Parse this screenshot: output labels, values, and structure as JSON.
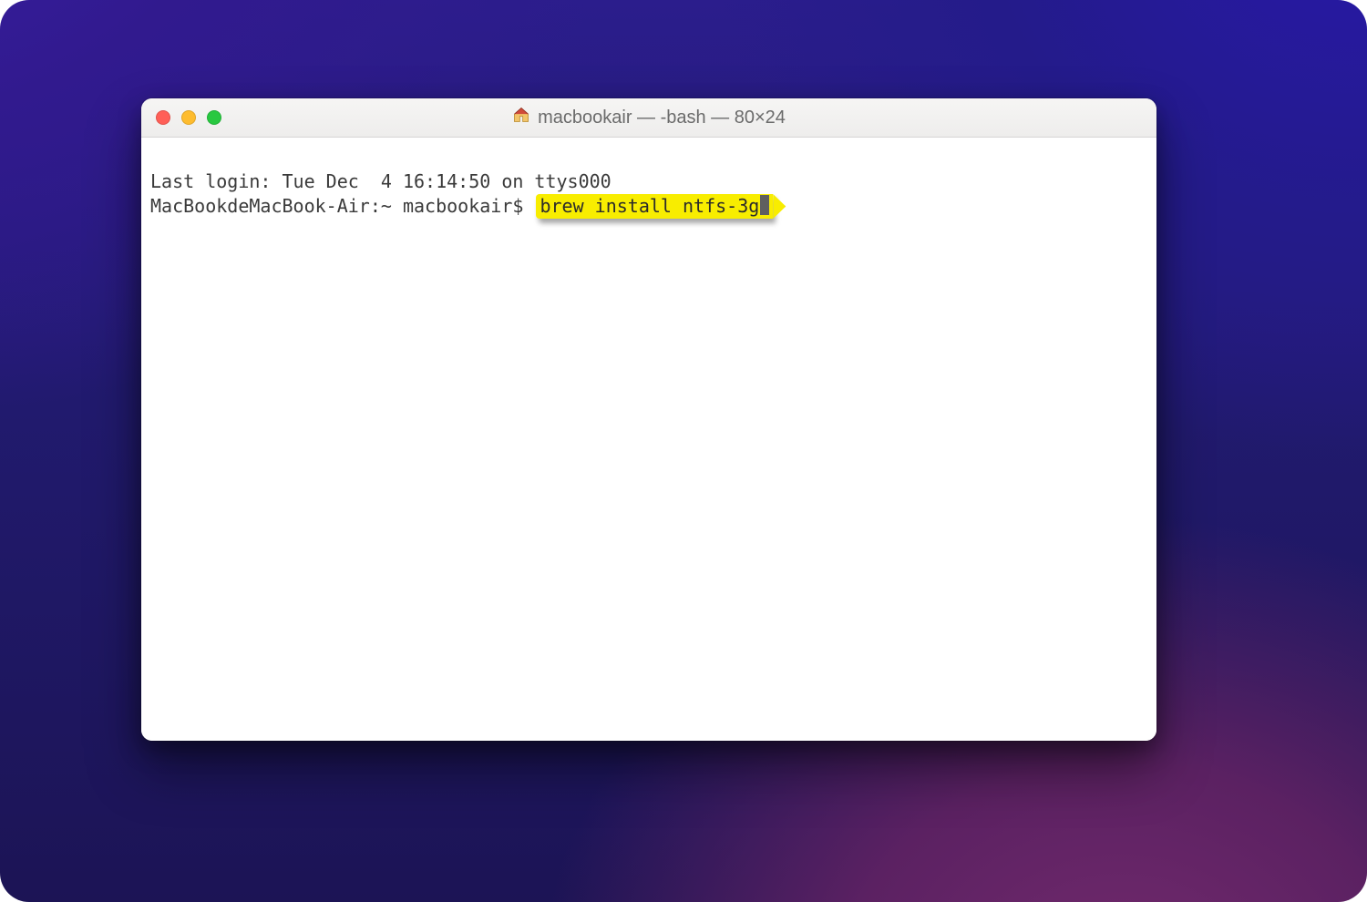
{
  "window": {
    "title": "macbookair — -bash — 80×24"
  },
  "terminal": {
    "login_line": "Last login: Tue Dec  4 16:14:50 on ttys000",
    "prompt": "MacBookdeMacBook-Air:~ macbookair$",
    "command": "brew install ntfs-3g"
  },
  "icons": {
    "home": "home-icon"
  }
}
